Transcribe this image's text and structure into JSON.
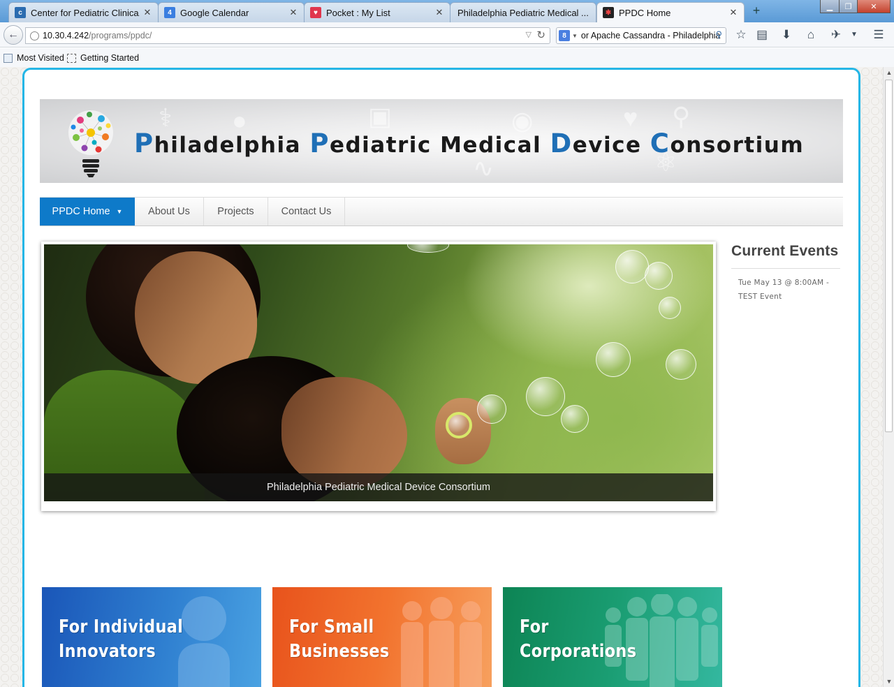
{
  "browser": {
    "tabs": [
      {
        "label": "Center for Pediatric Clinica...",
        "icon": "chop-icon",
        "color": "#2b6cb0"
      },
      {
        "label": "Google Calendar",
        "icon": "calendar-icon",
        "color": "#3a7ee0"
      },
      {
        "label": "Pocket : My List",
        "icon": "pocket-icon",
        "color": "#e0364d"
      },
      {
        "label": "Philadelphia Pediatric Medical ...",
        "icon": "",
        "color": ""
      },
      {
        "label": "PPDC Home",
        "icon": "joomla-icon",
        "color": "#222"
      }
    ],
    "calendar_icon_text": "4",
    "url_host": "10.30.4.242",
    "url_path": "/programs/ppdc/",
    "search_text": "or Apache Cassandra - Philadelphia",
    "bookmarks": [
      "Most Visited",
      "Getting Started"
    ]
  },
  "site": {
    "banner": {
      "title_parts": [
        {
          "cap": "P",
          "rest": "hiladelphia "
        },
        {
          "cap": "P",
          "rest": "ediatric Medical "
        },
        {
          "cap": "D",
          "rest": "evice "
        },
        {
          "cap": "C",
          "rest": "onsortium"
        }
      ]
    },
    "menu": [
      {
        "label": "PPDC Home",
        "active": true,
        "has_dropdown": true
      },
      {
        "label": "About Us"
      },
      {
        "label": "Projects"
      },
      {
        "label": "Contact Us"
      }
    ],
    "slideshow": {
      "caption": "Philadelphia Pediatric Medical Device Consortium"
    },
    "events": {
      "title": "Current Events",
      "items": [
        "Tue May 13 @ 8:00AM - TEST Event"
      ]
    },
    "tiles": [
      {
        "line1": "For Individual",
        "line2": "Innovators",
        "color_from": "#1c5fbf",
        "color_to": "#3b93dd"
      },
      {
        "line1": "For Small",
        "line2": "Businesses",
        "color_from": "#e8501a",
        "color_to": "#f79a54"
      },
      {
        "line1": "For",
        "line2": "Corporations",
        "color_from": "#0f8a5a",
        "color_to": "#30b59c"
      }
    ]
  }
}
